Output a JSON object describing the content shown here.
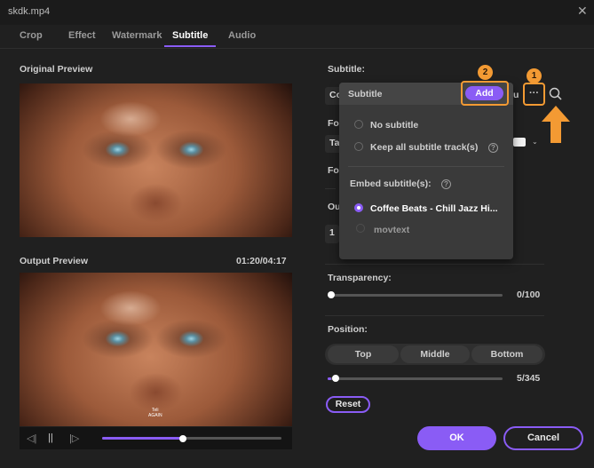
{
  "window": {
    "title": "skdk.mp4",
    "close_glyph": "✕"
  },
  "tabs": [
    "Crop",
    "Effect",
    "Watermark",
    "Subtitle",
    "Audio"
  ],
  "active_tab": "Subtitle",
  "left": {
    "original_label": "Original Preview",
    "output_label": "Output Preview",
    "timecode": "01:20/04:17",
    "caption_text": "Teli\nAGAIN",
    "player": {
      "prev_glyph": "◁|",
      "pause_glyph": "||",
      "next_glyph": "|▷",
      "progress": 0.45
    }
  },
  "right": {
    "subtitle_label": "Subtitle:",
    "subtitle_value_partial": "Co",
    "subtitle_value_tail": "u",
    "font_label_partial": "Fo",
    "font_value_partial": "Ta",
    "font_label2_partial": "Fo",
    "outline_label_partial": "Ou",
    "outline_value_partial": "1",
    "transparency_label": "Transparency:",
    "transparency_value": "0/100",
    "transparency_fraction": 0,
    "position_label": "Position:",
    "position_options": [
      "Top",
      "Middle",
      "Bottom"
    ],
    "position_value": "5/345",
    "position_fraction": 0.0145,
    "reset_label": "Reset"
  },
  "dropdown": {
    "header": "Subtitle",
    "add_label": "Add",
    "options": [
      {
        "label": "No subtitle",
        "selected": false,
        "enabled": true
      },
      {
        "label": "Keep all subtitle track(s)",
        "selected": false,
        "enabled": true,
        "help": "?"
      }
    ],
    "embed_label": "Embed subtitle(s):",
    "embed_help": "?",
    "embedded": [
      {
        "label": "Coffee Beats - Chill Jazz Hi...",
        "selected": true,
        "enabled": true
      },
      {
        "label": "movtext",
        "selected": false,
        "enabled": false
      }
    ]
  },
  "annotations": {
    "badge_1": "1",
    "badge_2": "2",
    "more_glyph": "···",
    "search_icon": "search-icon",
    "arrow_icon": "up-arrow-icon",
    "color": "#f39a33"
  },
  "footer": {
    "ok_label": "OK",
    "cancel_label": "Cancel"
  },
  "colors": {
    "accent": "#8a5cf5",
    "annotation": "#f39a33",
    "background": "#202020"
  }
}
